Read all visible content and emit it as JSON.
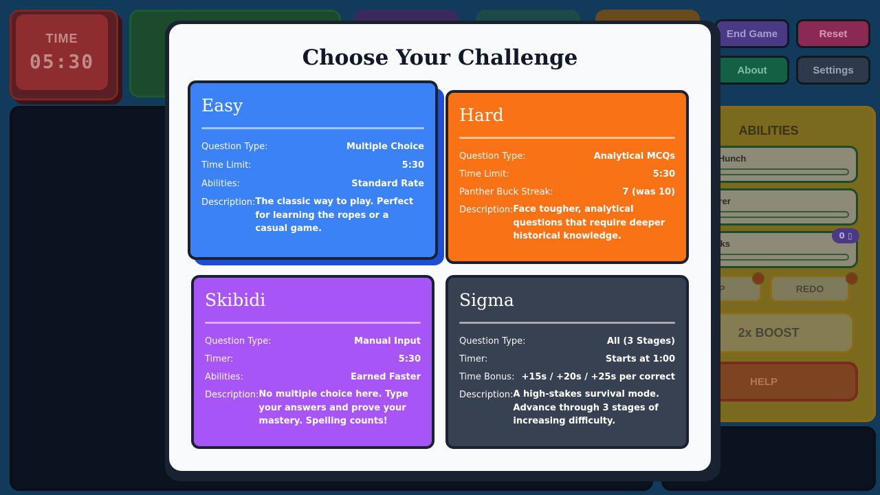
{
  "game": {
    "time_label": "TIME",
    "time_value": "05:30",
    "buttons": {
      "end_game": "End Game",
      "reset": "Reset",
      "about": "About",
      "settings": "Settings"
    },
    "abilities": {
      "title": "ABILITIES",
      "items": [
        "n's Hunch",
        "nkerer",
        "Bucks"
      ],
      "badge": "0 ▯",
      "skip_label": "P",
      "redo_label": "REDO",
      "boost_label": "2x BOOST",
      "help_label": "HELP"
    }
  },
  "modal": {
    "title": "Choose Your Challenge",
    "cards": {
      "easy": {
        "name": "Easy",
        "rows": [
          {
            "label": "Question Type:",
            "value": "Multiple Choice"
          },
          {
            "label": "Time Limit:",
            "value": "5:30"
          },
          {
            "label": "Abilities:",
            "value": "Standard Rate"
          }
        ],
        "description_label": "Description:",
        "description": "The classic way to play. Perfect for learning the ropes or a casual game."
      },
      "hard": {
        "name": "Hard",
        "rows": [
          {
            "label": "Question Type:",
            "value": "Analytical MCQs"
          },
          {
            "label": "Time Limit:",
            "value": "5:30"
          },
          {
            "label": "Panther Buck Streak:",
            "value": "7 (was 10)"
          }
        ],
        "description_label": "Description:",
        "description": "Face tougher, analytical questions that require deeper historical knowledge."
      },
      "skibidi": {
        "name": "Skibidi",
        "rows": [
          {
            "label": "Question Type:",
            "value": "Manual Input"
          },
          {
            "label": "Timer:",
            "value": "5:30"
          },
          {
            "label": "Abilities:",
            "value": "Earned Faster"
          }
        ],
        "description_label": "Description:",
        "description": "No multiple choice here. Type your answers and prove your mastery. Spelling counts!"
      },
      "sigma": {
        "name": "Sigma",
        "rows": [
          {
            "label": "Question Type:",
            "value": "All (3 Stages)"
          },
          {
            "label": "Timer:",
            "value": "Starts at 1:00"
          },
          {
            "label": "Time Bonus:",
            "value": "+15s / +20s / +25s per correct"
          }
        ],
        "description_label": "Description:",
        "description": "A high-stakes survival mode. Advance through 3 stages of increasing difficulty."
      }
    }
  },
  "colors": {
    "easy": "#3b82f6",
    "hard": "#f97316",
    "skibidi": "#a855f7",
    "sigma": "#374151"
  }
}
